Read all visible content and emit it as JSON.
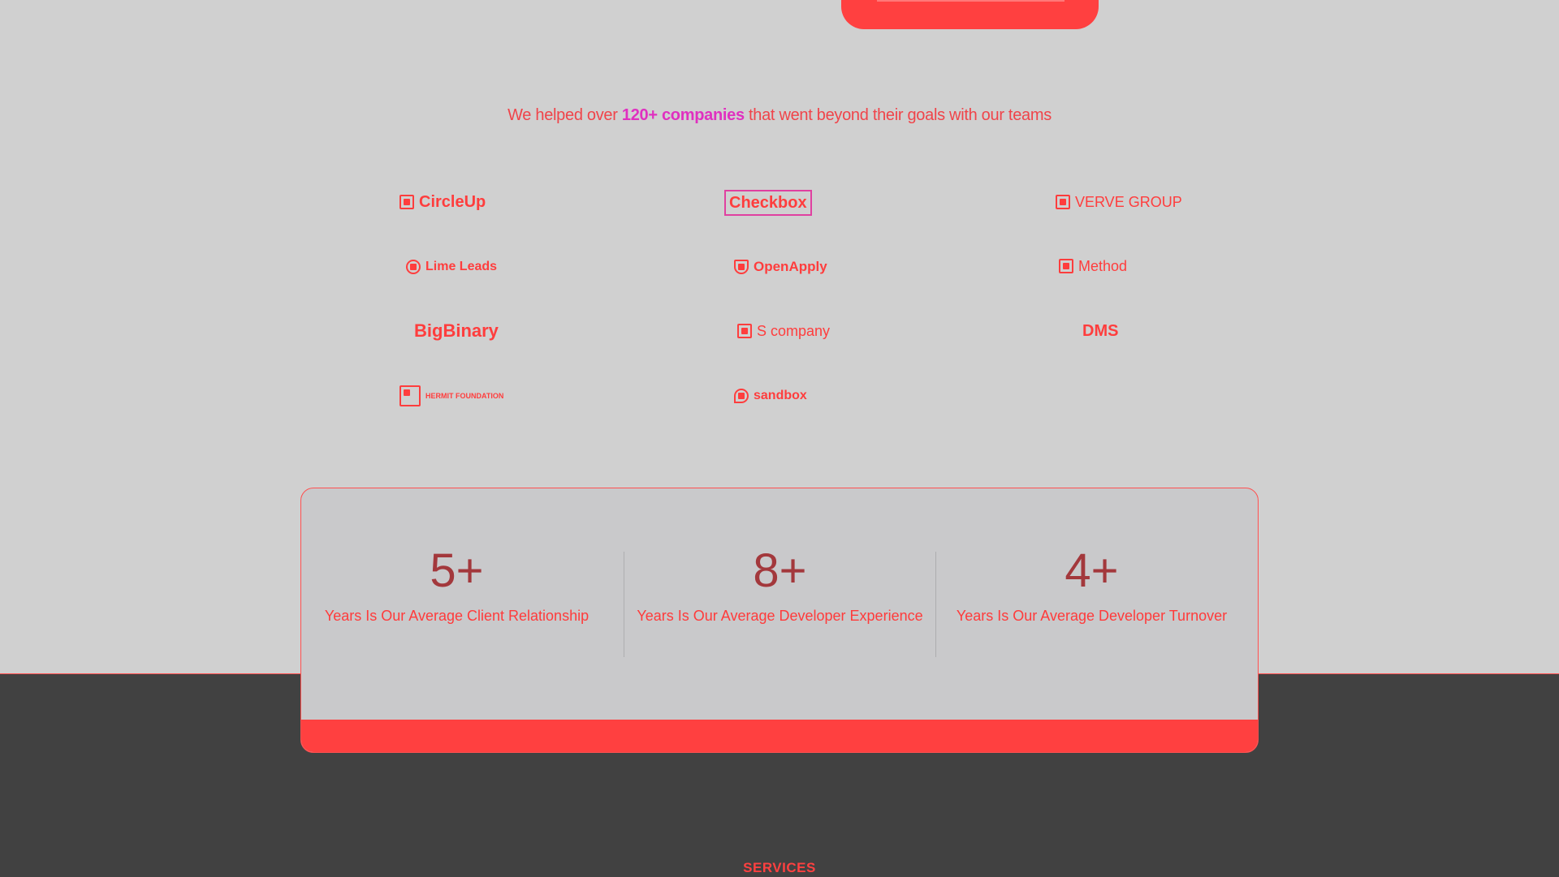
{
  "tagline": {
    "prefix": "We helped over ",
    "highlight": "120+ companies",
    "suffix": " that went beyond their goals with our teams"
  },
  "logos": [
    {
      "name": "CircleUp",
      "icon": "logo-mark-icon"
    },
    {
      "name": "Checkbox",
      "icon": "logo-mark-icon"
    },
    {
      "name": "VERVE GROUP",
      "icon": "logo-mark-icon"
    },
    {
      "name": "Lime Leads",
      "icon": "logo-mark-icon"
    },
    {
      "name": "OpenApply",
      "icon": "shield-icon"
    },
    {
      "name": "Method",
      "icon": "logo-mark-icon"
    },
    {
      "name": "BigBinary",
      "icon": "logo-mark-icon"
    },
    {
      "name": "S company",
      "icon": "logo-mark-icon"
    },
    {
      "name": "DMS",
      "icon": "logo-mark-icon"
    },
    {
      "name": "HERMIT FOUNDATION",
      "icon": "logo-mark-icon"
    },
    {
      "name": "sandbox",
      "icon": "chat-bubble-icon"
    }
  ],
  "stats": [
    {
      "value": "5+",
      "label": "Years Is Our Average Client Relationship"
    },
    {
      "value": "8+",
      "label": "Years Is Our Average Developer Experience"
    },
    {
      "value": "4+",
      "label": "Years Is Our Average Developer Turnover"
    }
  ],
  "footer": {
    "section_label": "SERVICES"
  },
  "colors": {
    "accent": "#ff4040",
    "highlight": "#e030c0",
    "background": "#d0d0d0",
    "dark_section": "#414141",
    "stat_number": "#a3383c"
  }
}
